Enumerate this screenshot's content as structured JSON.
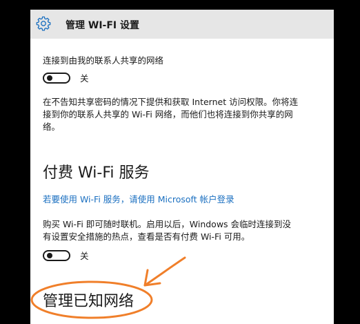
{
  "header": {
    "icon": "gear-icon",
    "title": "管理 WI-FI 设置"
  },
  "contacts_sharing": {
    "label": "连接到由我的联系人共享的网络",
    "toggle_state": "关",
    "description_lines": [
      "在不告知共享密码的情况下提供和获取 Internet 访问权限。你将连",
      "接到你的联系人共享的 Wi-Fi 网络，而他们也将连接到你共享的网",
      "络。"
    ]
  },
  "paid_wifi": {
    "heading": "付费 Wi-Fi 服务",
    "link": "若要使用 Wi-Fi 服务，请使用 Microsoft 帐户登录",
    "description_lines": [
      "购买 Wi-Fi 即可随时联机。启用以后，Windows 会临时连接到没",
      "有设置安全措施的热点，查看是否有付费 Wi-Fi 可用。"
    ],
    "toggle_state": "关"
  },
  "known_networks": {
    "heading": "管理已知网络"
  },
  "annotation": {
    "color": "#f07f2a"
  }
}
